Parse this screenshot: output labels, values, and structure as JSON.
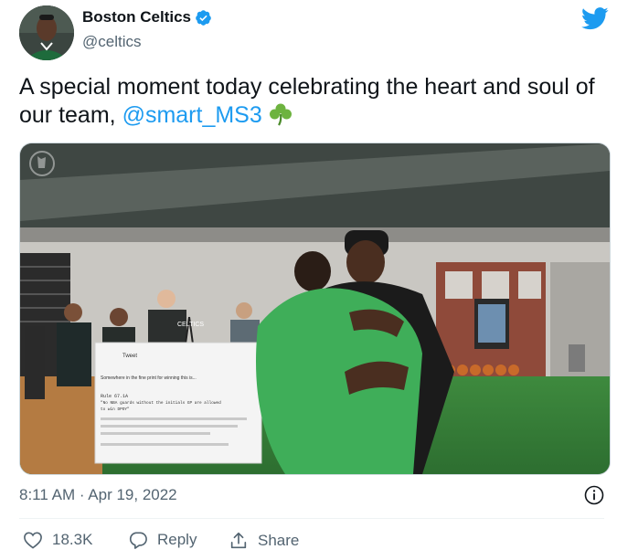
{
  "author": {
    "display_name": "Boston Celtics",
    "handle": "@celtics",
    "verified": true
  },
  "tweet": {
    "text_before": "A special moment today celebrating the heart and soul of our team, ",
    "mention": "@smart_MS3",
    "emoji": "shamrock-icon"
  },
  "media": {
    "whiteboard_tweet": {
      "header": "Tweet",
      "body_line1": "Somewhere in the fine print for winning this is...",
      "rule_title": "Rule 67.1A",
      "rule_line1": "\"No NBA guards without the initials GP are allowed",
      "rule_line2": "to win DPOY\""
    },
    "shirt_text": "CELTICS"
  },
  "meta": {
    "timestamp": "8:11 AM · Apr 19, 2022"
  },
  "actions": {
    "likes": "18.3K",
    "reply_label": "Reply",
    "share_label": "Share"
  },
  "colors": {
    "accent": "#1d9bf0",
    "text": "#0f1419",
    "muted": "#536471",
    "shamrock": "#6db33f"
  }
}
